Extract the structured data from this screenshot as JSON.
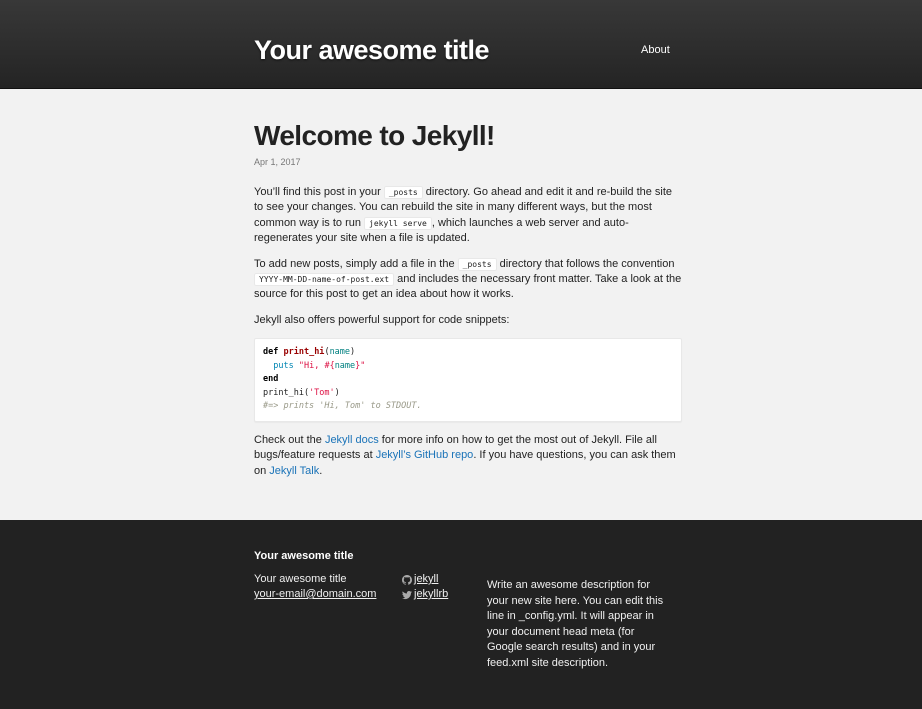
{
  "header": {
    "site_title": "Your awesome title",
    "nav": [
      {
        "label": "About"
      }
    ]
  },
  "post": {
    "title": "Welcome to Jekyll!",
    "date": "Apr 1, 2017",
    "p1": {
      "a": "You’ll find this post in your ",
      "code1": "_posts",
      "b": " directory. Go ahead and edit it and re-build the site to see your changes. You can rebuild the site in many different ways, but the most common way is to run ",
      "code2": "jekyll serve",
      "c": ", which launches a web server and auto-regenerates your site when a file is updated."
    },
    "p2": {
      "a": "To add new posts, simply add a file in the ",
      "code1": "_posts",
      "b": " directory that follows the convention ",
      "code2": "YYYY-MM-DD-name-of-post.ext",
      "c": " and includes the necessary front matter. Take a look at the source for this post to get an idea about how it works."
    },
    "p3": "Jekyll also offers powerful support for code snippets:",
    "code": {
      "def": "def",
      "fn": "print_hi",
      "arg": "name",
      "puts": "puts",
      "str_a": "\"Hi, #{",
      "str_arg": "name",
      "str_b": "}\"",
      "end": "end",
      "call": "print_hi(",
      "call_arg": "'Tom'",
      "call_end": ")",
      "comment": "#=> prints 'Hi, Tom' to STDOUT."
    },
    "p4": {
      "a": "Check out the ",
      "link1": "Jekyll docs",
      "b": " for more info on how to get the most out of Jekyll. File all bugs/feature requests at ",
      "link2": "Jekyll’s GitHub repo",
      "c": ". If you have questions, you can ask them on ",
      "link3": "Jekyll Talk",
      "d": "."
    }
  },
  "footer": {
    "heading": "Your awesome title",
    "name": "Your awesome title",
    "email": "your-email@domain.com",
    "github": "jekyll",
    "twitter": "jekyllrb",
    "description": "Write an awesome description for your new site here. You can edit this line in _config.yml. It will appear in your document head meta (for Google search results) and in your feed.xml site description."
  }
}
